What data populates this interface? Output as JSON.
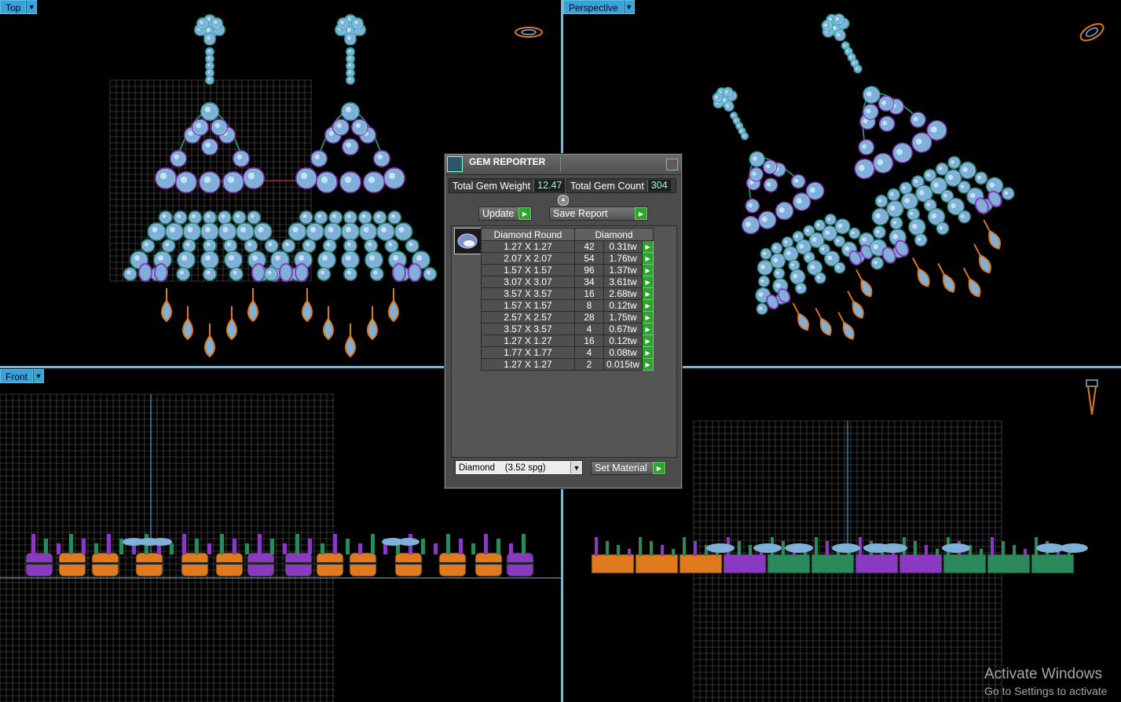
{
  "viewports": {
    "top": {
      "label": "Top"
    },
    "perspective": {
      "label": "Perspective"
    },
    "front": {
      "label": "Front"
    }
  },
  "gem_reporter": {
    "title": "GEM REPORTER",
    "close_glyph": "×",
    "total_weight_label": "Total Gem Weight",
    "total_weight_value": "12.47",
    "total_count_label": "Total Gem Count",
    "total_count_value": "304",
    "update_label": "Update",
    "save_report_label": "Save Report",
    "table": {
      "header_shape": "Diamond Round",
      "header_material": "Diamond",
      "rows": [
        {
          "size": "1.27 X 1.27",
          "count": "42",
          "weight": "0.31tw"
        },
        {
          "size": "2.07 X 2.07",
          "count": "54",
          "weight": "1.76tw"
        },
        {
          "size": "1.57 X 1.57",
          "count": "96",
          "weight": "1.37tw"
        },
        {
          "size": "3.07 X 3.07",
          "count": "34",
          "weight": "3.61tw"
        },
        {
          "size": "3.57 X 3.57",
          "count": "16",
          "weight": "2.68tw"
        },
        {
          "size": "1.57 X 1.57",
          "count": "8",
          "weight": "0.12tw"
        },
        {
          "size": "2.57 X 2.57",
          "count": "28",
          "weight": "1.75tw"
        },
        {
          "size": "3.57 X 3.57",
          "count": "4",
          "weight": "0.67tw"
        },
        {
          "size": "1.27 X 1.27",
          "count": "16",
          "weight": "0.12tw"
        },
        {
          "size": "1.77 X 1.77",
          "count": "4",
          "weight": "0.08tw"
        },
        {
          "size": "1.27 X 1.27",
          "count": "2",
          "weight": "0.015tw"
        }
      ]
    },
    "material_select_value": "Diamond    (3.52 spg)",
    "set_material_label": "Set Material"
  },
  "watermark": {
    "line1": "Activate Windows",
    "line2": "Go to Settings to activate"
  },
  "colors": {
    "viewport_label_bg": "#3aa3d6",
    "gem_blue": "#7fb0d8",
    "metal_purple": "#8a3ac0",
    "metal_orange": "#e07a1e",
    "metal_green": "#2a8a5a",
    "grid": "#8a8a8a"
  }
}
